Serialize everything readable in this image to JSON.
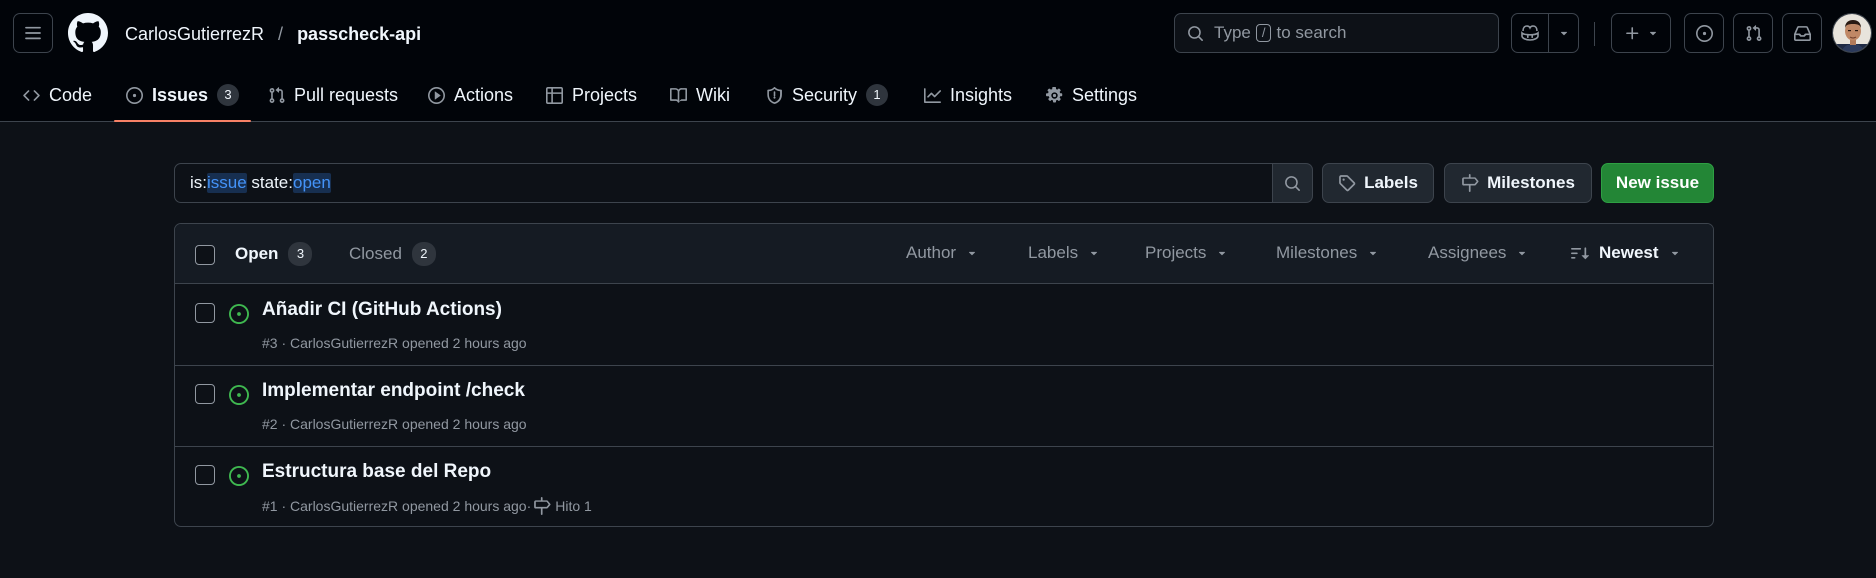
{
  "header": {
    "owner": "CarlosGutierrezR",
    "separator": "/",
    "repo": "passcheck-api",
    "search": {
      "prefix": "Type",
      "key": "/",
      "suffix": "to search"
    }
  },
  "nav": {
    "tabs": [
      {
        "label": "Code",
        "icon": "code-icon"
      },
      {
        "label": "Issues",
        "icon": "issue-opened-icon",
        "count": "3",
        "selected": true
      },
      {
        "label": "Pull requests",
        "icon": "git-pull-request-icon"
      },
      {
        "label": "Actions",
        "icon": "play-icon"
      },
      {
        "label": "Projects",
        "icon": "table-icon"
      },
      {
        "label": "Wiki",
        "icon": "book-icon"
      },
      {
        "label": "Security",
        "icon": "shield-icon",
        "count": "1"
      },
      {
        "label": "Insights",
        "icon": "graph-icon"
      },
      {
        "label": "Settings",
        "icon": "gear-icon"
      }
    ]
  },
  "filter": {
    "k1": "is:",
    "v1": "issue",
    "k2": " state:",
    "v2": "open"
  },
  "actions": {
    "labels": "Labels",
    "milestones": "Milestones",
    "new_issue": "New issue"
  },
  "list_header": {
    "open_label": "Open",
    "open_count": "3",
    "closed_label": "Closed",
    "closed_count": "2",
    "facets": [
      "Author",
      "Labels",
      "Projects",
      "Milestones",
      "Assignees"
    ],
    "sort": "Newest"
  },
  "issues": [
    {
      "title": "Añadir CI (GitHub Actions)",
      "meta": "#3 · CarlosGutierrezR opened 2 hours ago"
    },
    {
      "title": "Implementar endpoint /check",
      "meta": "#2 · CarlosGutierrezR opened 2 hours ago"
    },
    {
      "title": "Estructura base del Repo",
      "meta": "#1 · CarlosGutierrezR opened 2 hours ago",
      "separator": "·",
      "milestone": "Hito 1"
    }
  ],
  "colors": {
    "background": "#0d1117",
    "header_bg": "#010409",
    "border": "#3d444d",
    "accent_tab": "#f78166",
    "open_green": "#3fb950",
    "primary_button": "#238636",
    "token_blue": "#4493f8"
  }
}
